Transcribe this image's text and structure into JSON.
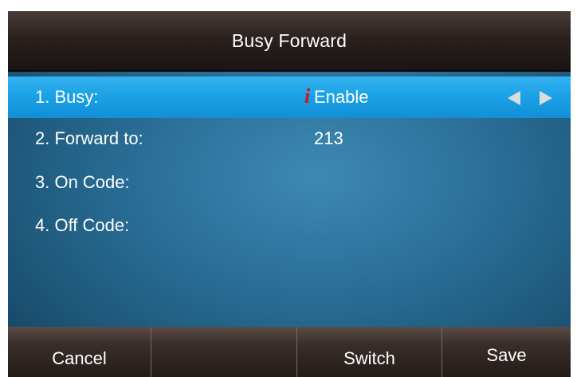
{
  "title": "Busy Forward",
  "rows": [
    {
      "label": "1. Busy:",
      "value": "Enable",
      "selected": true,
      "info_icon": "i",
      "arrows": "left-right-arrows-icon"
    },
    {
      "label": "2. Forward to:",
      "value": "213",
      "selected": false
    },
    {
      "label": "3. On Code:",
      "value": "",
      "selected": false
    },
    {
      "label": "4. Off Code:",
      "value": "",
      "selected": false
    }
  ],
  "softkeys": [
    {
      "label": "Cancel"
    },
    {
      "label": ""
    },
    {
      "label": "Switch"
    },
    {
      "label": "Save"
    }
  ],
  "colors": {
    "selected_row": "#1aa0e6",
    "info_icon": "#d8141b",
    "background": "#2a6f98"
  }
}
